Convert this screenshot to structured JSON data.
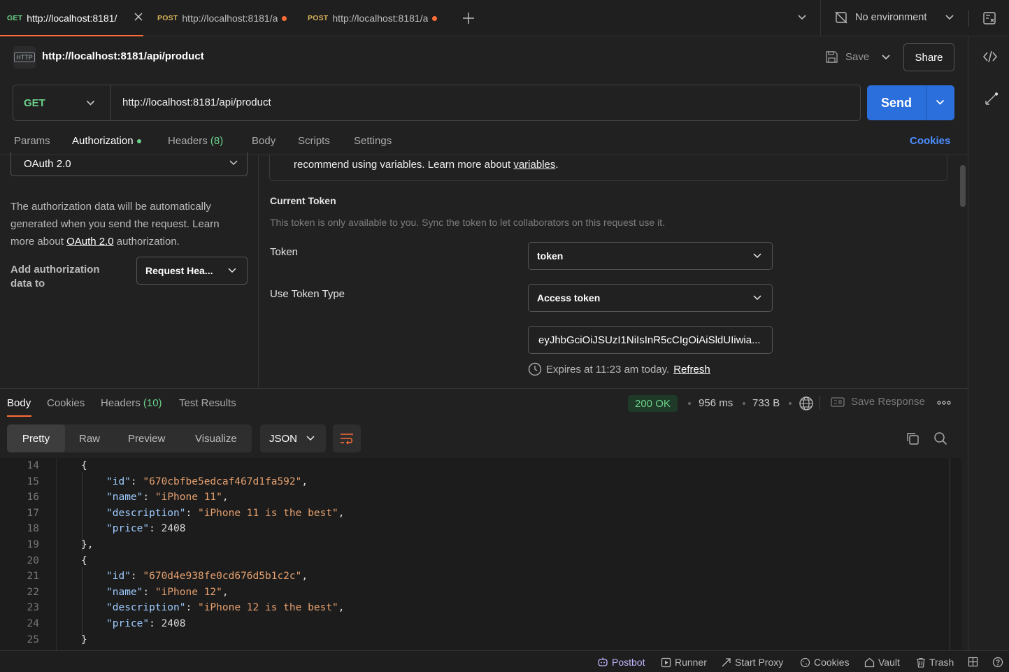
{
  "tabs": [
    {
      "method": "GET",
      "url": "http://localhost:8181/",
      "active": true
    },
    {
      "method": "POST",
      "url": "http://localhost:8181/a",
      "active": false
    },
    {
      "method": "POST",
      "url": "http://localhost:8181/a",
      "active": false
    }
  ],
  "environment": {
    "label": "No environment"
  },
  "request": {
    "protocol_badge": "HTTP",
    "title": "http://localhost:8181/api/product",
    "method": "GET",
    "url": "http://localhost:8181/api/product",
    "save_label": "Save",
    "share_label": "Share",
    "send_label": "Send"
  },
  "request_tabs": {
    "params": "Params",
    "authorization": "Authorization",
    "headers": "Headers",
    "headers_count": "(8)",
    "body": "Body",
    "scripts": "Scripts",
    "settings": "Settings",
    "cookies": "Cookies"
  },
  "auth": {
    "type": "OAuth 2.0",
    "description_1": "The authorization data will be automatically generated when you send the request. Learn more about",
    "description_link": "OAuth 2.0",
    "description_2": "authorization.",
    "add_to_label": "Add authorization data to",
    "add_to_value": "Request Hea...",
    "notice_text": "recommend using variables. Learn more about",
    "notice_link": "variables",
    "notice_end": ".",
    "current_token_title": "Current Token",
    "current_token_desc": "This token is only available to you. Sync the token to let collaborators on this request use it.",
    "token_label": "Token",
    "token_value": "token",
    "use_token_type_label": "Use Token Type",
    "use_token_type_value": "Access token",
    "token_string": "eyJhbGciOiJSUzI1NiIsInR5cCIgOiAiSldUIiwia...",
    "expires_text": "Expires at 11:23 am today.",
    "refresh_label": "Refresh"
  },
  "response": {
    "tabs": {
      "body": "Body",
      "cookies": "Cookies",
      "headers": "Headers",
      "headers_count": "(10)",
      "test_results": "Test Results"
    },
    "status": "200 OK",
    "time": "956 ms",
    "size": "733 B",
    "save_response": "Save Response",
    "views": {
      "pretty": "Pretty",
      "raw": "Raw",
      "preview": "Preview",
      "visualize": "Visualize"
    },
    "format": "JSON"
  },
  "code_lines": [
    {
      "num": "14",
      "text": "{"
    },
    {
      "num": "15",
      "key": "\"id\"",
      "value": "\"670cbfbe5edcaf467d1fa592\"",
      "end": ","
    },
    {
      "num": "16",
      "key": "\"name\"",
      "value": "\"iPhone 11\"",
      "end": ","
    },
    {
      "num": "17",
      "key": "\"description\"",
      "value": "\"iPhone 11 is the best\"",
      "end": ","
    },
    {
      "num": "18",
      "key": "\"price\"",
      "value": "2408",
      "end": ""
    },
    {
      "num": "19",
      "text": "},"
    },
    {
      "num": "20",
      "text": "{"
    },
    {
      "num": "21",
      "key": "\"id\"",
      "value": "\"670d4e938fe0cd676d5b1c2c\"",
      "end": ","
    },
    {
      "num": "22",
      "key": "\"name\"",
      "value": "\"iPhone 12\"",
      "end": ","
    },
    {
      "num": "23",
      "key": "\"description\"",
      "value": "\"iPhone 12 is the best\"",
      "end": ","
    },
    {
      "num": "24",
      "key": "\"price\"",
      "value": "2408",
      "end": ""
    },
    {
      "num": "25",
      "text": "}"
    }
  ],
  "statusbar": {
    "postbot": "Postbot",
    "runner": "Runner",
    "start_proxy": "Start Proxy",
    "cookies": "Cookies",
    "vault": "Vault",
    "trash": "Trash"
  },
  "colors": {
    "accent": "#ff6c37",
    "send": "#2a6fdb",
    "get_method": "#6bd18a",
    "status_ok": "#6bd18a",
    "link": "#4c8dff"
  }
}
